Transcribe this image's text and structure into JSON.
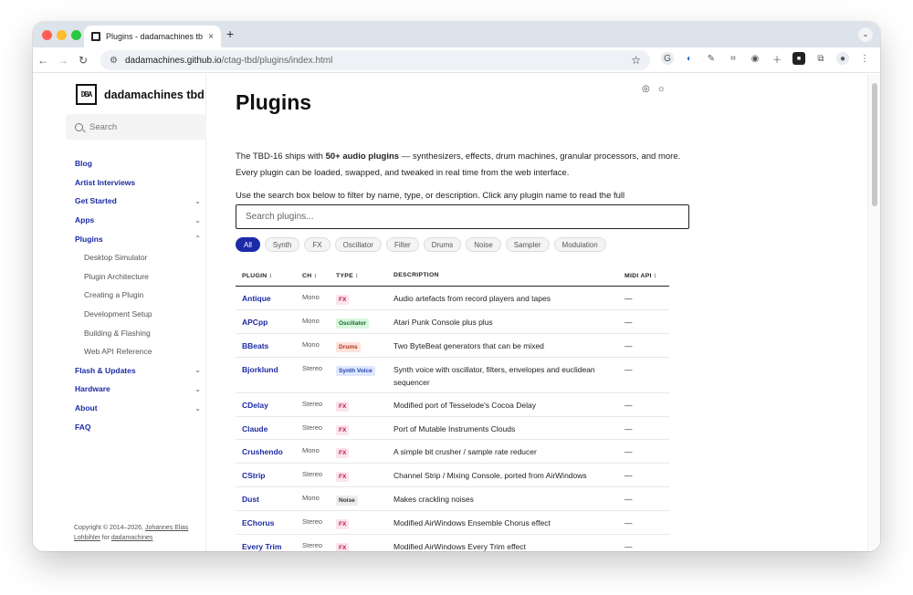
{
  "browser": {
    "tab_title": "Plugins - dadamachines tbd",
    "tab_close": "×",
    "new_tab": "+",
    "url_host": "dadamachines.github.io",
    "url_path": "/ctag-tbd/plugins/index.html"
  },
  "sidebar": {
    "logo_text": "DBA",
    "brand": "dadamachines tbd",
    "search_placeholder": "Search",
    "items": [
      {
        "label": "Blog",
        "type": "top",
        "chevron": ""
      },
      {
        "label": "Artist Interviews",
        "type": "top",
        "chevron": ""
      },
      {
        "label": "Get Started",
        "type": "top",
        "chevron": "⌄"
      },
      {
        "label": "Apps",
        "type": "top",
        "chevron": "⌄"
      },
      {
        "label": "Plugins",
        "type": "top",
        "chevron": "⌃"
      },
      {
        "label": "Desktop Simulator",
        "type": "sub",
        "chevron": ""
      },
      {
        "label": "Plugin Architecture",
        "type": "sub",
        "chevron": ""
      },
      {
        "label": "Creating a Plugin",
        "type": "sub",
        "chevron": ""
      },
      {
        "label": "Development Setup",
        "type": "sub",
        "chevron": ""
      },
      {
        "label": "Building & Flashing",
        "type": "sub",
        "chevron": ""
      },
      {
        "label": "Web API Reference",
        "type": "sub",
        "chevron": ""
      },
      {
        "label": "Flash & Updates",
        "type": "top",
        "chevron": "⌄"
      },
      {
        "label": "Hardware",
        "type": "top",
        "chevron": "⌄"
      },
      {
        "label": "About",
        "type": "top",
        "chevron": "⌄"
      },
      {
        "label": "FAQ",
        "type": "top",
        "chevron": ""
      }
    ],
    "copyright_prefix": "Copyright © 2014–2026,",
    "copyright_author": "Johannes Elias Lohbihler",
    "copyright_for": "for",
    "copyright_org": "dadamachines"
  },
  "main": {
    "title": "Plugins",
    "intro_before": "The TBD-16 ships with ",
    "intro_bold": "50+ audio plugins",
    "intro_after": " — synthesizers, effects, drum machines, granular processors, and more. Every plugin can be loaded, swapped, and tweaked in real time from the web interface.",
    "instructions": "Use the search box below to filter by name, type, or description. Click any plugin name to read the full documentation.",
    "plugin_search_placeholder": "Search plugins...",
    "filters": [
      "All",
      "Synth",
      "FX",
      "Oscillator",
      "Filter",
      "Drums",
      "Noise",
      "Sampler",
      "Modulation"
    ],
    "active_filter": "All",
    "columns": [
      "PLUGIN ↕",
      "CH ↕",
      "TYPE ↕",
      "DESCRIPTION",
      "MIDI API ↕"
    ],
    "rows": [
      {
        "name": "Antique",
        "ch": "Mono",
        "type": "FX",
        "desc": "Audio artefacts from record players and tapes",
        "midi": "—"
      },
      {
        "name": "APCpp",
        "ch": "Mono",
        "type": "Oscillator",
        "desc": "Atari Punk Console plus plus",
        "midi": "—"
      },
      {
        "name": "BBeats",
        "ch": "Mono",
        "type": "Drums",
        "desc": "Two ByteBeat generators that can be mixed",
        "midi": "—"
      },
      {
        "name": "Bjorklund",
        "ch": "Stereo",
        "type": "Synth Voice",
        "desc": "Synth voice with oscillator, filters, envelopes and euclidean sequencer",
        "midi": "—"
      },
      {
        "name": "CDelay",
        "ch": "Stereo",
        "type": "FX",
        "desc": "Modified port of Tesselode's Cocoa Delay",
        "midi": "—"
      },
      {
        "name": "Claude",
        "ch": "Stereo",
        "type": "FX",
        "desc": "Port of Mutable Instruments Clouds",
        "midi": "—"
      },
      {
        "name": "Crushendo",
        "ch": "Mono",
        "type": "FX",
        "desc": "A simple bit crusher / sample rate reducer",
        "midi": "—"
      },
      {
        "name": "CStrip",
        "ch": "Stereo",
        "type": "FX",
        "desc": "Channel Strip / Mixing Console, ported from AirWindows",
        "midi": "—"
      },
      {
        "name": "Dust",
        "ch": "Mono",
        "type": "Noise",
        "desc": "Makes crackling noises",
        "midi": "—"
      },
      {
        "name": "EChorus",
        "ch": "Stereo",
        "type": "FX",
        "desc": "Modified AirWindows Ensemble Chorus effect",
        "midi": "—"
      },
      {
        "name": "Every Trim",
        "ch": "Stereo",
        "type": "FX",
        "desc": "Modified AirWindows Every Trim effect",
        "midi": "—"
      }
    ]
  },
  "colors": {
    "accent": "#1d2aa8",
    "link": "#1c2ba3"
  }
}
